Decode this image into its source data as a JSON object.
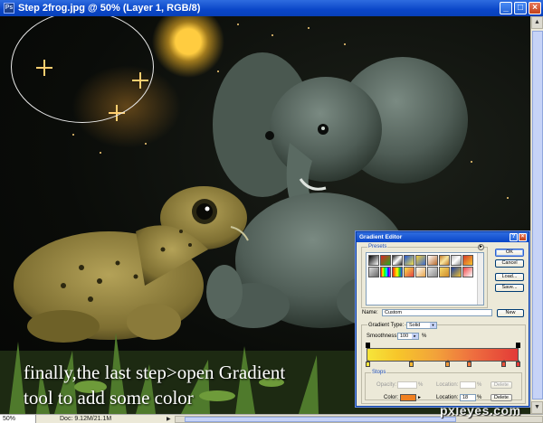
{
  "window": {
    "title": "Step 2frog.jpg @ 50% (Layer 1, RGB/8)",
    "app_icon_label": "Ps",
    "minimize": "_",
    "maximize": "□",
    "close": "×"
  },
  "canvas": {
    "caption_lines": [
      "finally,the last step>open Gradient",
      "tool to add  some color"
    ]
  },
  "statusbar": {
    "zoom": "50%",
    "doc_info": "Doc: 9.12M/21.1M",
    "arrow": "▶"
  },
  "watermark": "pxleyes.com",
  "gradient_editor": {
    "title": "Gradient Editor",
    "help": "?",
    "close": "×",
    "presets_label": "Presets",
    "presets_menu": "►",
    "buttons": {
      "ok": "OK",
      "cancel": "Cancel",
      "load": "Load...",
      "save": "Save...",
      "new": "New"
    },
    "name_label": "Name:",
    "name_value": "Custom",
    "gradient_type_label": "Gradient Type:",
    "gradient_type_value": "Solid",
    "smoothness_label": "Smoothness:",
    "smoothness_value": "100",
    "percent": "%",
    "stops_label": "Stops",
    "opacity_label": "Opacity:",
    "location_label": "Location:",
    "delete": "Delete",
    "color_label": "Color:",
    "color_location_value": "18",
    "stop_color": "#f08020"
  },
  "preset_swatches": [
    "linear-gradient(135deg,#000,#fff)",
    "linear-gradient(135deg,#d22,#2a2)",
    "linear-gradient(135deg,#222,#fff 50%,#222)",
    "linear-gradient(135deg,#2155d4,#f5e14a)",
    "linear-gradient(135deg,#f5d03a,#3b6bd0)",
    "linear-gradient(135deg,#fff,#b96b2c)",
    "linear-gradient(135deg,#c47b2a,#f8e6a0,#c47b2a)",
    "linear-gradient(135deg,#c0c0c0,#fff,#909090)",
    "linear-gradient(135deg,#d43a2a,#f7c52f)",
    "linear-gradient(135deg,#ddd,#666)",
    "linear-gradient(90deg,#f00,#ff0,#0f0,#0ff,#00f,#f0f)",
    "linear-gradient(90deg,#e22,#f90,#ff0,#2c2,#24f)",
    "linear-gradient(135deg,#f9e34a,#e34141)",
    "linear-gradient(135deg,#fff,#e6a44a)",
    "linear-gradient(135deg,#e6e6e6,#8a8a8a)",
    "linear-gradient(135deg,#f6da6a,#cf8a2a)",
    "linear-gradient(135deg,#1a3fa0,#f0c030)",
    "linear-gradient(135deg,#e44,#fff)"
  ]
}
